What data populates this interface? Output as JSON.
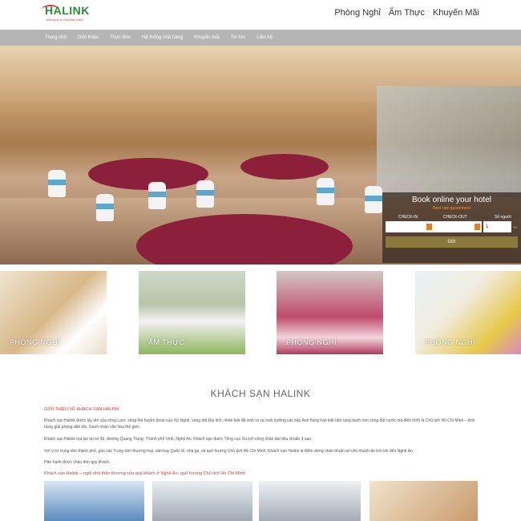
{
  "header": {
    "logo_text": "HALINK",
    "logo_tagline": "welcome to HALINK hotel",
    "topnav": [
      "Phòng Nghỉ",
      "Ẩm Thực",
      "Khuyến Mãi"
    ]
  },
  "menu": [
    "Trang chủ",
    "Giới thiệu",
    "Thực đơn",
    "Hệ thống nhà hàng",
    "Khuyến mãi",
    "Tin tức",
    "Liên hệ"
  ],
  "booking": {
    "title": "Book online your hotel",
    "subtitle": "Best rate guaranteed",
    "checkin_label": "CHECK-IN",
    "checkout_label": "CHECK-OUT",
    "guests_label": "Số người",
    "guests_value": "1",
    "submit_label": "Gửi"
  },
  "thumbnails": [
    "PHÒNG NGHỈ",
    "ẨM THỰC",
    "PHÒNG NGHỈ",
    "PHÒNG NGHỈ"
  ],
  "intro": {
    "title": "KHÁCH SẠN HALINK",
    "heading": "GIỚI THIỆU VỀ KHÁCH SẠN HALINK",
    "p1": "Khách sạn Halink được lấy tên của sông Lam- sông Mẹ huyền thoại của Xứ Nghệ, vùng đất Địa linh, nhân kiệt đã sinh ra và nuôi dưỡng các bậc Anh hùng hào kiệt làm rạng danh non sông đất nước mà điển hình là Chủ tịch Hồ Chí Minh – Anh hùng giải phóng dân tộc, Danh nhân văn hóa thế giới.",
    "p2": "Khách sạn Halink tọa lạc tại số 43, đường Quang Trung, Thành phố Vinh, Nghệ An. Khách sạn được Tổng cục Du lịch công nhận đạt tiêu chuẩn 3 sao.",
    "p3": "Với vị trí trung tâm thành phố, gần các Trung tâm thương mại, sân bay Quốc tế, nhà ga, và quê hương Chủ tịch Hồ Chí Minh, Khách sạn Halink là điểm dừng chân thuận lợi cho khách du lịch khi đến Nghệ An.",
    "p4": "Hân hạnh được chào đón quý khách.",
    "slogan": "Khách sạn Halink – ngôi nhà thân thương của quý khách ở Nghệ An- quê hương Chủ tịch Hồ Chí Minh"
  }
}
